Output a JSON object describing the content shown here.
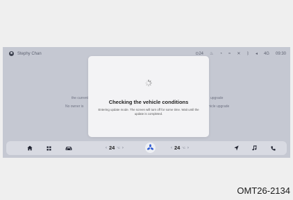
{
  "status_bar": {
    "user_name": "Stephy Chan",
    "temperature": "24",
    "signal": "4G",
    "time": "09:30"
  },
  "background": {
    "left_line1": "the current",
    "left_line2": "No owner is",
    "right_line1": "upgrade",
    "right_line2": "vehicle upgrade"
  },
  "dialog": {
    "title": "Checking the vehicle conditions",
    "message": "Entering update mode. The screen will turn off for some time. Wait until the update is completed."
  },
  "dock": {
    "left_temp": "24",
    "right_temp": "24",
    "temp_unit": "°C"
  },
  "caption": "OMT26-2134",
  "colors": {
    "screen_bg": "#c5c8d2",
    "dialog_bg": "#f3f3f5",
    "dock_bg": "#d8dae2",
    "fan_accent": "#2f5bd3"
  },
  "icons": [
    "person-icon",
    "steering-heat-icon",
    "seat-icon",
    "wifi-icon",
    "mute-icon",
    "bluetooth-icon",
    "volume-icon",
    "home-icon",
    "apps-icon",
    "car-icon",
    "fan-icon",
    "navigation-icon",
    "music-icon",
    "phone-icon",
    "spinner-icon"
  ]
}
